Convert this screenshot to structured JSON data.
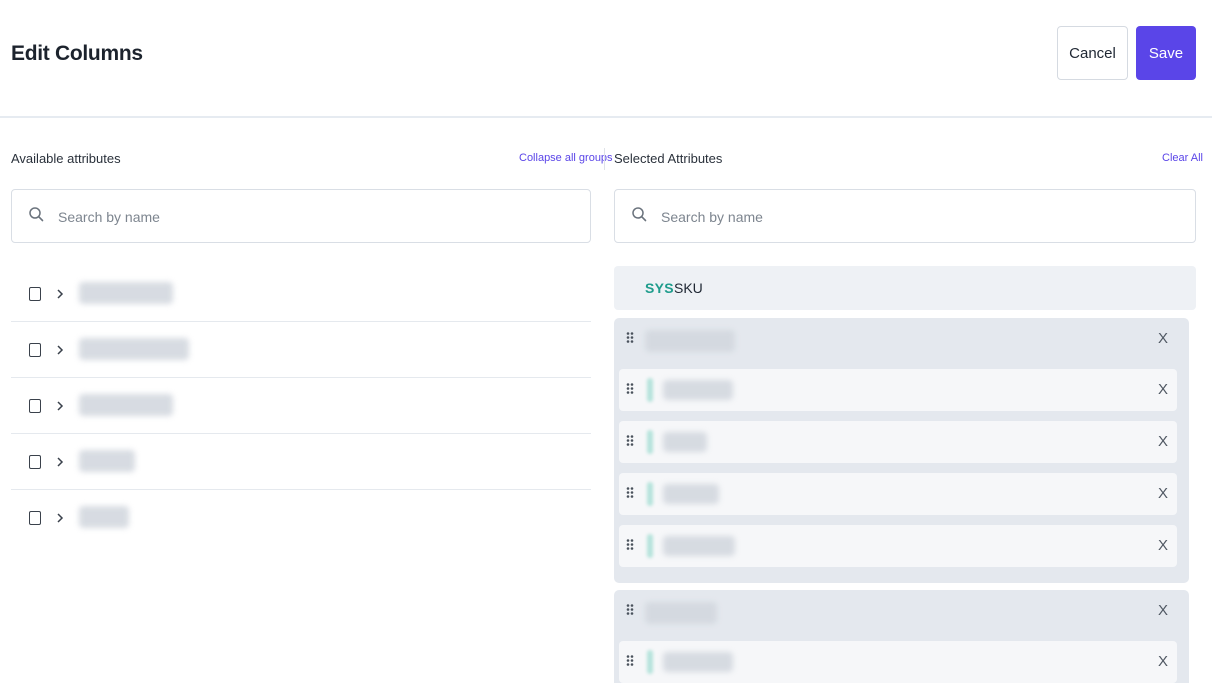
{
  "header": {
    "title": "Edit Columns",
    "cancel_label": "Cancel",
    "save_label": "Save"
  },
  "available": {
    "label": "Available attributes",
    "collapse_link": "Collapse all groups",
    "search_placeholder": "Search by name",
    "group_count": 5
  },
  "selected": {
    "label": "Selected Attributes",
    "clear_link": "Clear All",
    "search_placeholder": "Search by name",
    "pinned": {
      "badge": "SYS",
      "name": "SKU"
    },
    "remove_label": "X",
    "group_count": 2,
    "visible_child_rows": 5
  },
  "colors": {
    "accent": "#5a45e8",
    "sys_badge": "#1e9c8c",
    "group_background": "#e4e8ee",
    "divider": "#e5e9ee"
  },
  "icons": [
    "search-icon",
    "checkbox-icon",
    "chevron-right-icon",
    "drag-handle-icon"
  ]
}
